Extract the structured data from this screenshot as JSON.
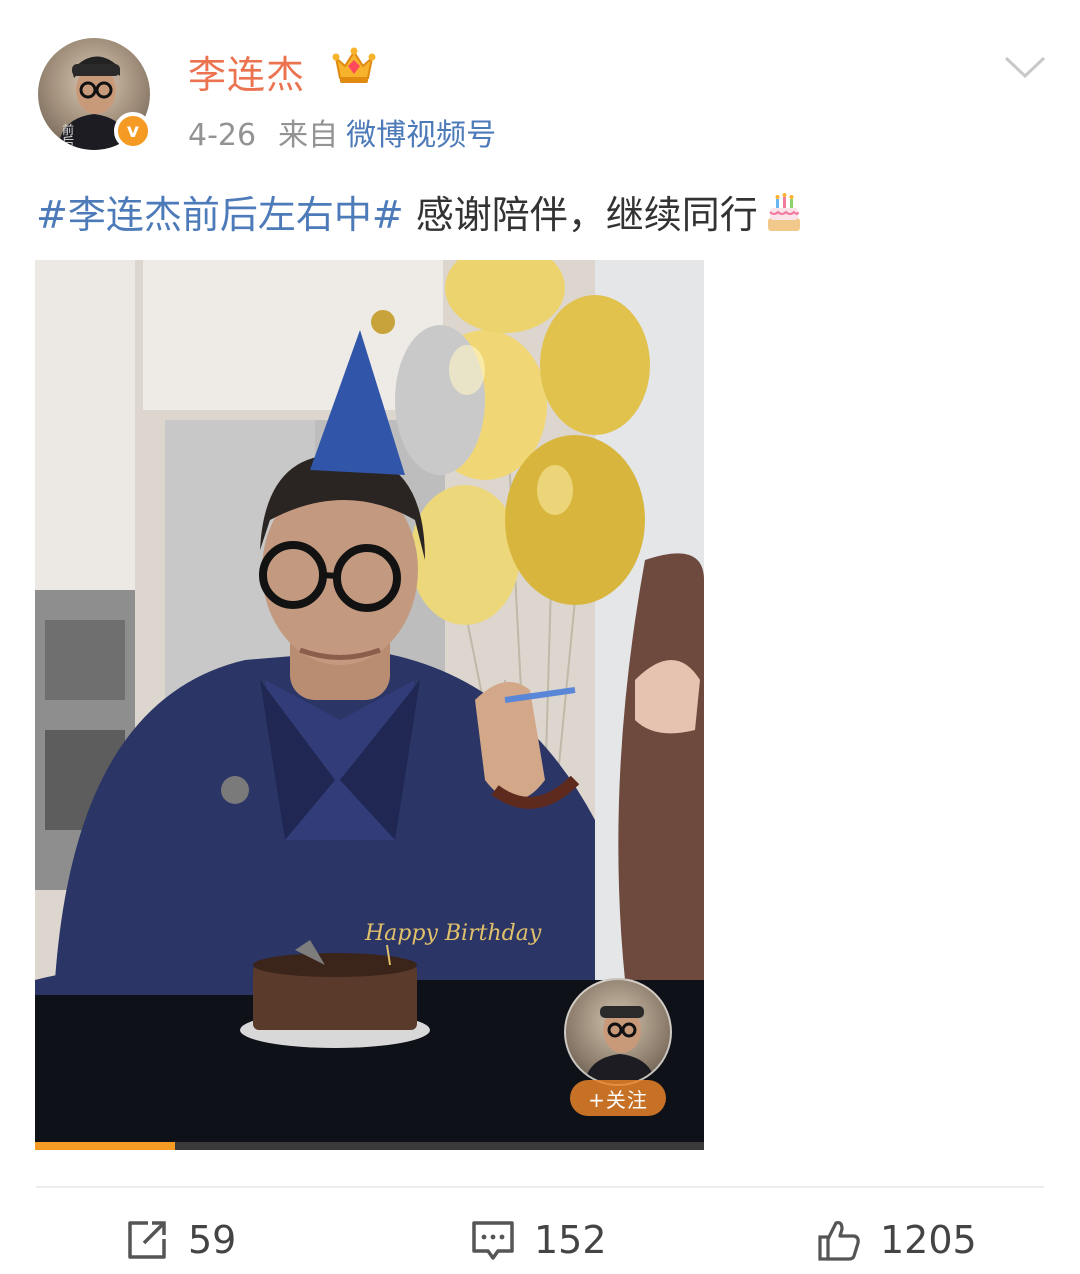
{
  "post": {
    "author": "李连杰",
    "date": "4-26",
    "from_label": "来自",
    "source": "微博视频号",
    "topic": "#李连杰前后左右中#",
    "text": " 感谢陪伴，继续同行"
  },
  "video": {
    "follow_label": "+关注",
    "progress": 0.21,
    "cake_topper_text": "Happy Birthday"
  },
  "actions": {
    "repost_count": "59",
    "comment_count": "152",
    "like_count": "1205"
  },
  "icons": [
    "crown-icon",
    "verified-badge-icon",
    "chevron-down-icon",
    "birthday-cake-emoji",
    "repost-icon",
    "comment-icon",
    "like-icon"
  ],
  "colors": {
    "username": "#eb7350",
    "link": "#4d7ab8",
    "meta": "#939393",
    "accent": "#f59a23"
  }
}
